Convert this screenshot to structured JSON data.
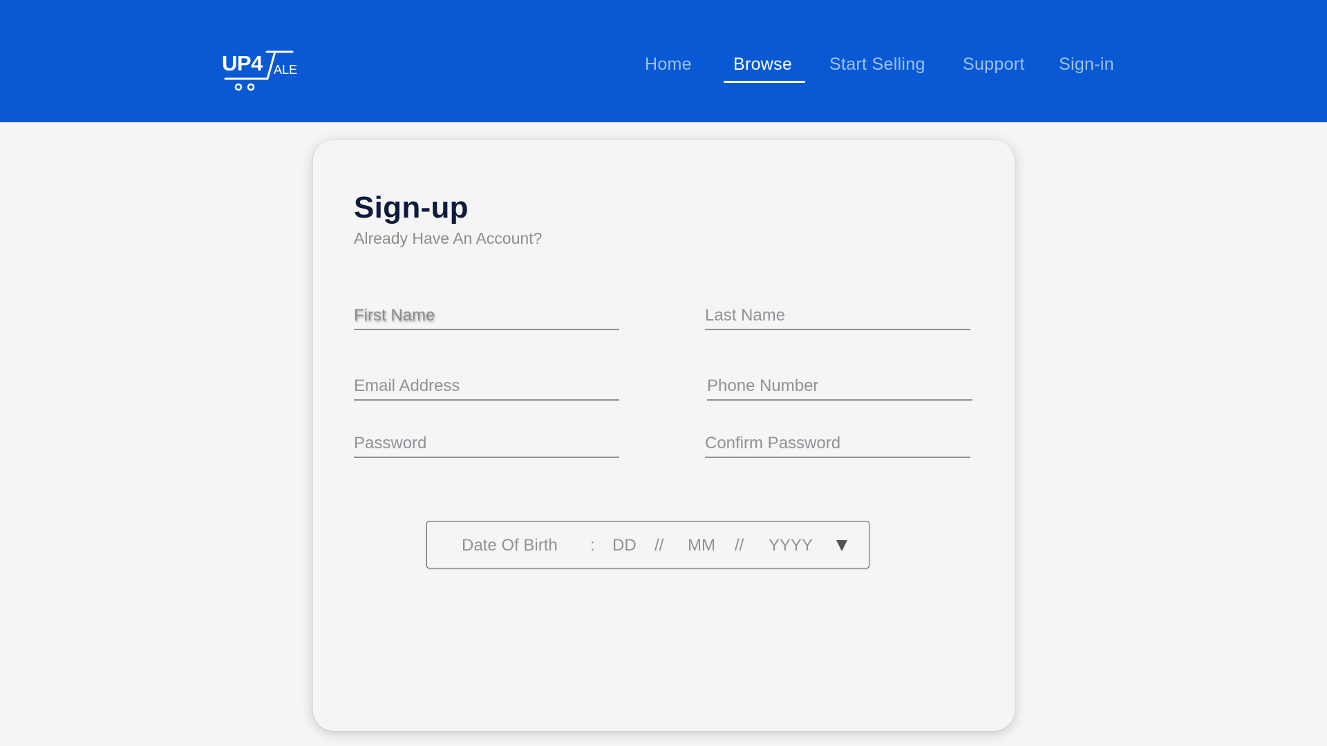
{
  "brand": {
    "main": "UP4",
    "suffix": "ALE"
  },
  "nav": {
    "home": "Home",
    "browse": "Browse",
    "start_selling": "Start Selling",
    "support": "Support",
    "sign_in": "Sign-in",
    "active": "Browse"
  },
  "form": {
    "title": "Sign-up",
    "subtitle": "Already Have An Account?",
    "first_name_placeholder": "First Name",
    "last_name_placeholder": "Last Name",
    "email_placeholder": "Email Address",
    "phone_placeholder": "Phone Number",
    "password_placeholder": "Password",
    "confirm_password_placeholder": "Confirm Password",
    "dob": {
      "label": "Date Of Birth",
      "colon": ":",
      "day": "DD",
      "sep1": "//",
      "month": "MM",
      "sep2": "//",
      "year": "YYYY",
      "icon": "caret-down-icon"
    }
  },
  "colors": {
    "header": "#0a59d4",
    "nav_inactive": "#9cc0ef",
    "nav_active": "#ffffff",
    "title": "#0f1b3d",
    "background": "#f4f5f4"
  }
}
